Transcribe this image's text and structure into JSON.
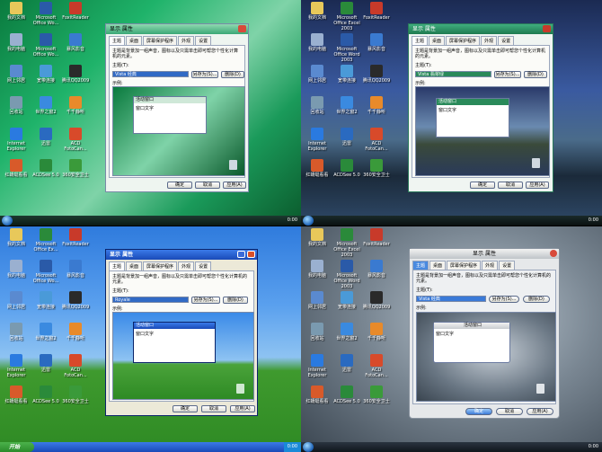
{
  "desktop_icons": {
    "q1": [
      {
        "label": "我的文档",
        "color": "#e8c85a"
      },
      {
        "label": "Microsoft Office Wo...",
        "color": "#2a5aa8"
      },
      {
        "label": "FoxitReader",
        "color": "#c83a2a"
      },
      {
        "label": "我的电脑",
        "color": "#9ab0d0"
      },
      {
        "label": "Microsoft Office Wo...",
        "color": "#2a5aa8"
      },
      {
        "label": "暴风影音",
        "color": "#3a7ad0"
      },
      {
        "label": "网上邻居",
        "color": "#5a8ad0"
      },
      {
        "label": "宽带连接",
        "color": "#4a9ad8"
      },
      {
        "label": "腾讯QQ2009",
        "color": "#2a2a2a"
      },
      {
        "label": "回收站",
        "color": "#7a9ab0"
      },
      {
        "label": "世界之窗2",
        "color": "#3a8ae0"
      },
      {
        "label": "千千静听",
        "color": "#e88a2a"
      },
      {
        "label": "Internet Explorer",
        "color": "#2a7ae0"
      },
      {
        "label": "迅雷",
        "color": "#2a6ac0"
      },
      {
        "label": "ACD FotoCan...",
        "color": "#d84a2a"
      },
      {
        "label": "红蜻蜓看看",
        "color": "#d85a2a"
      },
      {
        "label": "ACDSee 5.0",
        "color": "#2a8a3a"
      },
      {
        "label": "360安全卫士",
        "color": "#3a9a3a"
      }
    ],
    "q2": [
      {
        "label": "我的文档",
        "color": "#e8c85a"
      },
      {
        "label": "Microsoft Office Excel 2003",
        "color": "#2a8a3a"
      },
      {
        "label": "FoxitReader",
        "color": "#c83a2a"
      },
      {
        "label": "我的电脑",
        "color": "#9ab0d0"
      },
      {
        "label": "Microsoft Office Word 2003",
        "color": "#2a5aa8"
      },
      {
        "label": "暴风影音",
        "color": "#3a7ad0"
      },
      {
        "label": "网上邻居",
        "color": "#5a8ad0"
      },
      {
        "label": "宽带连接",
        "color": "#4a9ad8"
      },
      {
        "label": "腾讯QQ2009",
        "color": "#2a2a2a"
      },
      {
        "label": "回收站",
        "color": "#7a9ab0"
      },
      {
        "label": "世界之窗2",
        "color": "#3a8ae0"
      },
      {
        "label": "千千静听",
        "color": "#e88a2a"
      },
      {
        "label": "Internet Explorer",
        "color": "#2a7ae0"
      },
      {
        "label": "迅雷",
        "color": "#2a6ac0"
      },
      {
        "label": "ACD FotoCan...",
        "color": "#d84a2a"
      },
      {
        "label": "红蜻蜓看看",
        "color": "#d85a2a"
      },
      {
        "label": "ACDSee 5.0",
        "color": "#2a8a3a"
      },
      {
        "label": "360安全卫士",
        "color": "#3a9a3a"
      }
    ],
    "q3": [
      {
        "label": "我的文档",
        "color": "#e8c85a"
      },
      {
        "label": "Microsoft Office Ex...",
        "color": "#2a8a3a"
      },
      {
        "label": "FoxitReader",
        "color": "#c83a2a"
      },
      {
        "label": "我的电脑",
        "color": "#9ab0d0"
      },
      {
        "label": "Microsoft Office Wo...",
        "color": "#2a5aa8"
      },
      {
        "label": "暴风影音",
        "color": "#3a7ad0"
      },
      {
        "label": "网上邻居",
        "color": "#5a8ad0"
      },
      {
        "label": "宽带连接",
        "color": "#4a9ad8"
      },
      {
        "label": "腾讯QQ2009",
        "color": "#2a2a2a"
      },
      {
        "label": "回收站",
        "color": "#7a9ab0"
      },
      {
        "label": "世界之窗2",
        "color": "#3a8ae0"
      },
      {
        "label": "千千静听",
        "color": "#e88a2a"
      },
      {
        "label": "Internet Explorer",
        "color": "#2a7ae0"
      },
      {
        "label": "迅雷",
        "color": "#2a6ac0"
      },
      {
        "label": "ACD FotoCan...",
        "color": "#d84a2a"
      },
      {
        "label": "红蜻蜓看看",
        "color": "#d85a2a"
      },
      {
        "label": "ACDSee 5.0",
        "color": "#2a8a3a"
      },
      {
        "label": "360安全卫士",
        "color": "#3a9a3a"
      }
    ],
    "q4": [
      {
        "label": "我的文档",
        "color": "#e8c85a"
      },
      {
        "label": "Microsoft Office Excel 2003",
        "color": "#2a8a3a"
      },
      {
        "label": "FoxitReader",
        "color": "#c83a2a"
      },
      {
        "label": "我的电脑",
        "color": "#9ab0d0"
      },
      {
        "label": "Microsoft Office Word 2003",
        "color": "#2a5aa8"
      },
      {
        "label": "暴风影音",
        "color": "#3a7ad0"
      },
      {
        "label": "网上邻居",
        "color": "#5a8ad0"
      },
      {
        "label": "宽带连接",
        "color": "#4a9ad8"
      },
      {
        "label": "腾讯QQ2009",
        "color": "#2a2a2a"
      },
      {
        "label": "回收站",
        "color": "#7a9ab0"
      },
      {
        "label": "世界之窗2",
        "color": "#3a8ae0"
      },
      {
        "label": "千千静听",
        "color": "#e88a2a"
      },
      {
        "label": "Internet Explorer",
        "color": "#2a7ae0"
      },
      {
        "label": "迅雷",
        "color": "#2a6ac0"
      },
      {
        "label": "ACD FotoCan...",
        "color": "#d84a2a"
      },
      {
        "label": "红蜻蜓看看",
        "color": "#d85a2a"
      },
      {
        "label": "ACDSee 5.0",
        "color": "#2a8a3a"
      },
      {
        "label": "360安全卫士",
        "color": "#3a9a3a"
      }
    ]
  },
  "dialog": {
    "title_q1": "显示 属性",
    "title_q2": "显示 属性",
    "title_q3": "显示 属性",
    "title_q4": "显示 属性",
    "tabs": [
      "主题",
      "桌面",
      "屏幕保护程序",
      "外观",
      "设置"
    ],
    "description": "主题是背景加一组声音，图标以及只需单击即可帮您个性化计算机的元素。",
    "theme_label": "主题(T):",
    "theme_value_q1": "Vista 经典",
    "theme_value_q2": "Vista 翡翠绿",
    "theme_value_q3": "Royale",
    "theme_value_q4": "Vista 经典",
    "save_as": "另存为(S)...",
    "delete": "删除(D)",
    "sample_label": "示例:",
    "active_window": "活动窗口",
    "window_text": "窗口文字",
    "ok": "确定",
    "cancel": "取消",
    "apply": "应用(A)"
  },
  "taskbar": {
    "xp_start": "开始",
    "clock_q1": "0:00",
    "clock_q2": "0:00",
    "clock_q3": "0:00",
    "clock_q4": "0:00"
  },
  "colors": {
    "vista_green_title": "#2fb46a",
    "xp_blue_title": "#2a5fd0",
    "selection_blue": "#316ac5"
  }
}
